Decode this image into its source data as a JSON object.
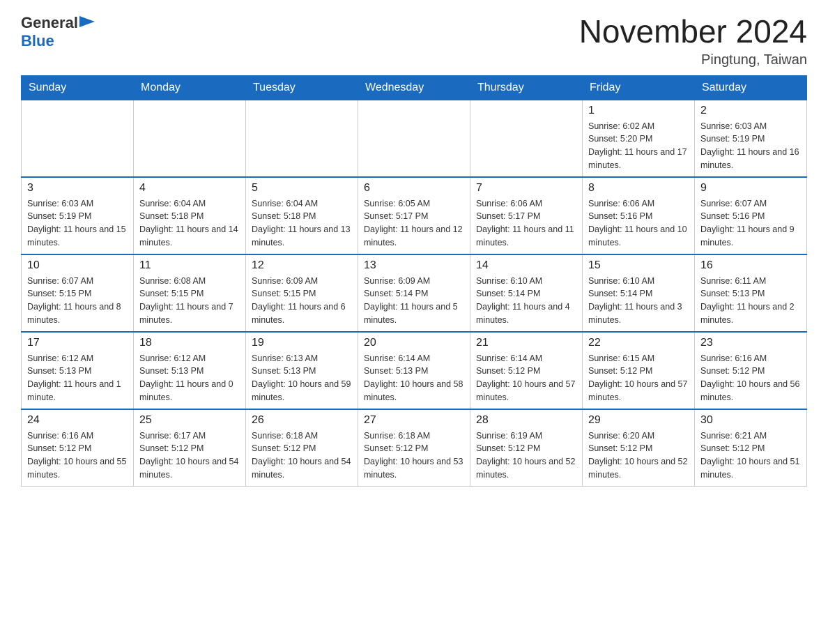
{
  "logo": {
    "text_general": "General",
    "text_blue": "Blue",
    "triangle_char": "▶"
  },
  "title": {
    "month_year": "November 2024",
    "location": "Pingtung, Taiwan"
  },
  "weekdays": [
    "Sunday",
    "Monday",
    "Tuesday",
    "Wednesday",
    "Thursday",
    "Friday",
    "Saturday"
  ],
  "weeks": [
    [
      {
        "day": "",
        "info": ""
      },
      {
        "day": "",
        "info": ""
      },
      {
        "day": "",
        "info": ""
      },
      {
        "day": "",
        "info": ""
      },
      {
        "day": "",
        "info": ""
      },
      {
        "day": "1",
        "info": "Sunrise: 6:02 AM\nSunset: 5:20 PM\nDaylight: 11 hours and 17 minutes."
      },
      {
        "day": "2",
        "info": "Sunrise: 6:03 AM\nSunset: 5:19 PM\nDaylight: 11 hours and 16 minutes."
      }
    ],
    [
      {
        "day": "3",
        "info": "Sunrise: 6:03 AM\nSunset: 5:19 PM\nDaylight: 11 hours and 15 minutes."
      },
      {
        "day": "4",
        "info": "Sunrise: 6:04 AM\nSunset: 5:18 PM\nDaylight: 11 hours and 14 minutes."
      },
      {
        "day": "5",
        "info": "Sunrise: 6:04 AM\nSunset: 5:18 PM\nDaylight: 11 hours and 13 minutes."
      },
      {
        "day": "6",
        "info": "Sunrise: 6:05 AM\nSunset: 5:17 PM\nDaylight: 11 hours and 12 minutes."
      },
      {
        "day": "7",
        "info": "Sunrise: 6:06 AM\nSunset: 5:17 PM\nDaylight: 11 hours and 11 minutes."
      },
      {
        "day": "8",
        "info": "Sunrise: 6:06 AM\nSunset: 5:16 PM\nDaylight: 11 hours and 10 minutes."
      },
      {
        "day": "9",
        "info": "Sunrise: 6:07 AM\nSunset: 5:16 PM\nDaylight: 11 hours and 9 minutes."
      }
    ],
    [
      {
        "day": "10",
        "info": "Sunrise: 6:07 AM\nSunset: 5:15 PM\nDaylight: 11 hours and 8 minutes."
      },
      {
        "day": "11",
        "info": "Sunrise: 6:08 AM\nSunset: 5:15 PM\nDaylight: 11 hours and 7 minutes."
      },
      {
        "day": "12",
        "info": "Sunrise: 6:09 AM\nSunset: 5:15 PM\nDaylight: 11 hours and 6 minutes."
      },
      {
        "day": "13",
        "info": "Sunrise: 6:09 AM\nSunset: 5:14 PM\nDaylight: 11 hours and 5 minutes."
      },
      {
        "day": "14",
        "info": "Sunrise: 6:10 AM\nSunset: 5:14 PM\nDaylight: 11 hours and 4 minutes."
      },
      {
        "day": "15",
        "info": "Sunrise: 6:10 AM\nSunset: 5:14 PM\nDaylight: 11 hours and 3 minutes."
      },
      {
        "day": "16",
        "info": "Sunrise: 6:11 AM\nSunset: 5:13 PM\nDaylight: 11 hours and 2 minutes."
      }
    ],
    [
      {
        "day": "17",
        "info": "Sunrise: 6:12 AM\nSunset: 5:13 PM\nDaylight: 11 hours and 1 minute."
      },
      {
        "day": "18",
        "info": "Sunrise: 6:12 AM\nSunset: 5:13 PM\nDaylight: 11 hours and 0 minutes."
      },
      {
        "day": "19",
        "info": "Sunrise: 6:13 AM\nSunset: 5:13 PM\nDaylight: 10 hours and 59 minutes."
      },
      {
        "day": "20",
        "info": "Sunrise: 6:14 AM\nSunset: 5:13 PM\nDaylight: 10 hours and 58 minutes."
      },
      {
        "day": "21",
        "info": "Sunrise: 6:14 AM\nSunset: 5:12 PM\nDaylight: 10 hours and 57 minutes."
      },
      {
        "day": "22",
        "info": "Sunrise: 6:15 AM\nSunset: 5:12 PM\nDaylight: 10 hours and 57 minutes."
      },
      {
        "day": "23",
        "info": "Sunrise: 6:16 AM\nSunset: 5:12 PM\nDaylight: 10 hours and 56 minutes."
      }
    ],
    [
      {
        "day": "24",
        "info": "Sunrise: 6:16 AM\nSunset: 5:12 PM\nDaylight: 10 hours and 55 minutes."
      },
      {
        "day": "25",
        "info": "Sunrise: 6:17 AM\nSunset: 5:12 PM\nDaylight: 10 hours and 54 minutes."
      },
      {
        "day": "26",
        "info": "Sunrise: 6:18 AM\nSunset: 5:12 PM\nDaylight: 10 hours and 54 minutes."
      },
      {
        "day": "27",
        "info": "Sunrise: 6:18 AM\nSunset: 5:12 PM\nDaylight: 10 hours and 53 minutes."
      },
      {
        "day": "28",
        "info": "Sunrise: 6:19 AM\nSunset: 5:12 PM\nDaylight: 10 hours and 52 minutes."
      },
      {
        "day": "29",
        "info": "Sunrise: 6:20 AM\nSunset: 5:12 PM\nDaylight: 10 hours and 52 minutes."
      },
      {
        "day": "30",
        "info": "Sunrise: 6:21 AM\nSunset: 5:12 PM\nDaylight: 10 hours and 51 minutes."
      }
    ]
  ]
}
